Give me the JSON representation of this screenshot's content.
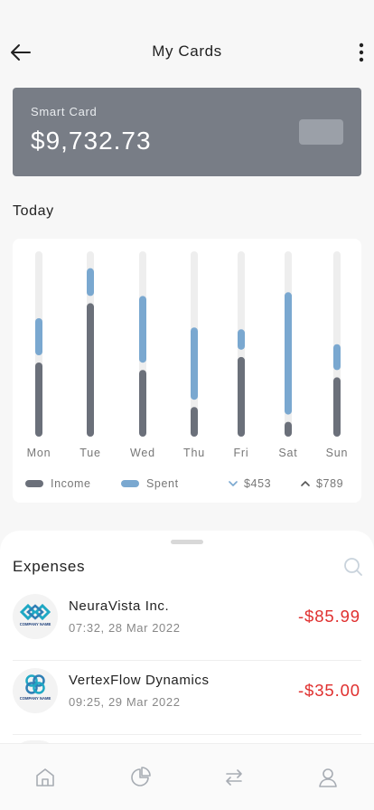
{
  "header": {
    "title": "My Cards",
    "back_icon": "arrow-left-icon",
    "more_icon": "more-vertical-icon"
  },
  "card": {
    "label": "Smart Card",
    "balance": "$9,732.73",
    "background_color": "#787d86"
  },
  "today": {
    "title": "Today"
  },
  "chart_data": {
    "type": "bar",
    "title": "",
    "categories": [
      "Mon",
      "Tue",
      "Wed",
      "Thu",
      "Fri",
      "Sat",
      "Sun"
    ],
    "ylim": [
      0,
      100
    ],
    "series": [
      {
        "name": "Income",
        "color": "#6b707a",
        "values": [
          40,
          72,
          36,
          16,
          43,
          8,
          32
        ]
      },
      {
        "name": "Spent",
        "color": "#7aa8d0",
        "values": [
          20,
          15,
          36,
          39,
          11,
          66,
          14
        ]
      }
    ],
    "legend": {
      "income_label": "Income",
      "spent_label": "Spent",
      "min_value": "$453",
      "max_value": "$789",
      "placement": "bottom"
    }
  },
  "expenses": {
    "title": "Expenses",
    "search_icon": "search-icon",
    "items": [
      {
        "name": "NeuraVista Inc.",
        "datetime": "07:32, 28 Mar 2022",
        "amount": "-$85.99",
        "logo_caption": "COMPANY NAME"
      },
      {
        "name": "VertexFlow Dynamics",
        "datetime": "09:25, 29 Mar 2022",
        "amount": "-$35.00",
        "logo_caption": "COMPANY NAME"
      }
    ]
  },
  "tabbar": {
    "items": [
      {
        "icon": "home-icon"
      },
      {
        "icon": "pie-chart-icon"
      },
      {
        "icon": "transfer-icon"
      },
      {
        "icon": "user-icon"
      }
    ]
  },
  "colors": {
    "accent": "#7aa8d0",
    "income": "#6b707a",
    "negative": "#e0302f",
    "track": "#eeeeee"
  }
}
